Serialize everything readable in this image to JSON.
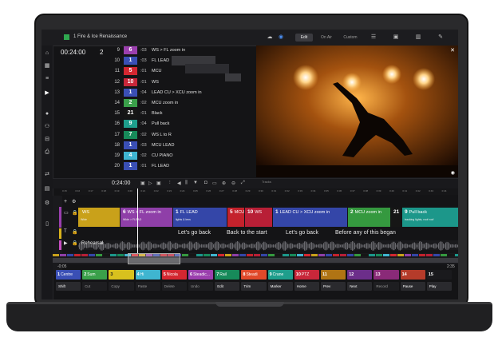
{
  "app": {
    "project_title": "1 Fire & Ice Renaissance",
    "status_color": "#2fa84f"
  },
  "modes": {
    "edit": "Edit",
    "on_air": "On Air",
    "custom": "Custom"
  },
  "header": {
    "timecode": "00:24:00",
    "layer_count": "2"
  },
  "cues": [
    {
      "num": "9",
      "id": "6",
      "dur": ":03",
      "desc": "WS > FL zoom in",
      "color": "#9b3fae"
    },
    {
      "num": "10",
      "id": "1",
      "dur": ":03",
      "desc": "FL LEAD",
      "color": "#3a4fb5"
    },
    {
      "num": "11",
      "id": "5",
      "dur": ":01",
      "desc": "MCU",
      "color": "#d42730"
    },
    {
      "num": "12",
      "id": "10",
      "dur": ":01",
      "desc": "WS",
      "color": "#c8273a"
    },
    {
      "num": "13",
      "id": "1",
      "dur": ":04",
      "desc": "LEAD CU > XCU zoom in",
      "color": "#3a4fb5"
    },
    {
      "num": "14",
      "id": "2",
      "dur": ":02",
      "desc": "MCU zoom in",
      "color": "#3aa04a"
    },
    {
      "num": "15",
      "id": "21",
      "dur": ":01",
      "desc": "Black",
      "color": "#161616"
    },
    {
      "num": "16",
      "id": "9",
      "dur": ":04",
      "desc": "Pull back",
      "color": "#1e9e8c"
    },
    {
      "num": "17",
      "id": "7",
      "dur": ":02",
      "desc": "WS L to R",
      "color": "#178a5a"
    },
    {
      "num": "18",
      "id": "1",
      "dur": ":03",
      "desc": "MCU LEAD",
      "color": "#3a4fb5"
    },
    {
      "num": "19",
      "id": "4",
      "dur": ":02",
      "desc": "CU PIANO",
      "color": "#3fb5d0"
    },
    {
      "num": "20",
      "id": "1",
      "dur": ":01",
      "desc": "FL LEAD",
      "color": "#3a4fb5"
    }
  ],
  "transport": {
    "timecode": "0:24:00",
    "tracks_label": "Tracks"
  },
  "ruler": [
    "0:15",
    "0:16",
    "0:17",
    "0:18",
    "0:19",
    "0:20",
    "0:21",
    "0:22",
    "0:23",
    "0:24",
    "0:25",
    "0:26",
    "0:27",
    "0:28",
    "0:29",
    "0:30",
    "0:31",
    "0:32",
    "0:33",
    "0:34",
    "0:35",
    "0:36",
    "0:37",
    "0:38",
    "0:39",
    "0:40",
    "0:41",
    "0:42",
    "0:43",
    "0:44"
  ],
  "clips": [
    {
      "id": "",
      "title": "WS",
      "sub": "Wide",
      "color": "#c9a11a"
    },
    {
      "id": "6",
      "title": "WS > FL zoom in",
      "sub": "Wide > FLEAD",
      "color": "#8f3fa8"
    },
    {
      "id": "1",
      "title": "FL LEAD",
      "sub": "lights & lens",
      "color": "#3446a8"
    },
    {
      "id": "5",
      "title": "MCU",
      "sub": "",
      "color": "#c4222c"
    },
    {
      "id": "10",
      "title": "WS",
      "sub": "",
      "color": "#b81f36"
    },
    {
      "id": "1",
      "title": "LEAD CU > XCU zoom in",
      "sub": "",
      "color": "#3446a8"
    },
    {
      "id": "2",
      "title": "MCU zoom in",
      "sub": "",
      "color": "#35993f"
    },
    {
      "id": "21",
      "title": "",
      "sub": "",
      "color": "#161616"
    },
    {
      "id": "9",
      "title": "Pull back",
      "sub": "tracking lights, roof roof",
      "color": "#1c978a"
    }
  ],
  "lyrics": [
    "Let's go back",
    "Back to the start",
    "Let's go back",
    "Before any of this began"
  ],
  "audio": {
    "label": "Rehearsal"
  },
  "overview": {
    "start": "-0:05",
    "end": "2:35"
  },
  "keys": [
    {
      "n": "1",
      "label": "Centre",
      "color": "#3a4fb5"
    },
    {
      "n": "2",
      "label": "Sum",
      "color": "#3aa04a"
    },
    {
      "n": "3",
      "label": "",
      "color": "#d8c11e"
    },
    {
      "n": "4",
      "label": "Hi",
      "color": "#3fb5d0"
    },
    {
      "n": "5",
      "label": "Nicola",
      "color": "#d42730"
    },
    {
      "n": "6",
      "label": "Steadic...",
      "color": "#9b3fae"
    },
    {
      "n": "7",
      "label": "Rail",
      "color": "#178a5a"
    },
    {
      "n": "8",
      "label": "Steadi",
      "color": "#e0492a"
    },
    {
      "n": "9",
      "label": "Crane",
      "color": "#1e9e8c"
    },
    {
      "n": "10",
      "label": "PTZ",
      "color": "#c8273a"
    },
    {
      "n": "11",
      "label": "",
      "color": "#b07414"
    },
    {
      "n": "12",
      "label": "",
      "color": "#6c2e8a"
    },
    {
      "n": "13",
      "label": "",
      "color": "#8a2a78"
    },
    {
      "n": "14",
      "label": "",
      "color": "#b53b2a"
    },
    {
      "n": "15",
      "label": "",
      "color": "#1a1a1d"
    }
  ],
  "controls": [
    {
      "label": "Shift",
      "on": true
    },
    {
      "label": "Cut",
      "on": false
    },
    {
      "label": "Copy",
      "on": false
    },
    {
      "label": "Paste",
      "on": false
    },
    {
      "label": "Delete",
      "on": false
    },
    {
      "label": "Undo",
      "on": false
    },
    {
      "label": "Edit",
      "on": true
    },
    {
      "label": "Trim",
      "on": true
    },
    {
      "label": "Marker",
      "on": true
    },
    {
      "label": "Home",
      "on": true
    },
    {
      "label": "Prev",
      "on": true
    },
    {
      "label": "Next",
      "on": true
    },
    {
      "label": "Record",
      "on": false
    },
    {
      "label": "Pause",
      "on": true
    },
    {
      "label": "Play",
      "on": true
    }
  ]
}
